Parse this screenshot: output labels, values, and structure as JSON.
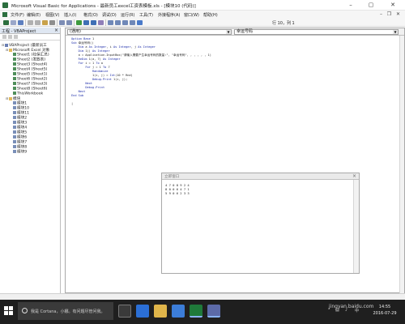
{
  "window": {
    "title": "Microsoft Visual Basic for Applications - 最新员工excel工资表模板.xls - [模块10 (代码)]"
  },
  "menu": {
    "items": [
      "文件(F)",
      "编辑(E)",
      "视图(V)",
      "插入(I)",
      "格式(O)",
      "调试(D)",
      "运行(R)",
      "工具(T)",
      "外接程序(A)",
      "窗口(W)",
      "帮助(H)"
    ]
  },
  "toolbar": {
    "position": "行 10，列 1"
  },
  "project_panel": {
    "title": "工程 - VBAProject",
    "tree": [
      {
        "text": "VBAProject (最新员工",
        "level": 0,
        "icon": "project-icon",
        "expander": "-"
      },
      {
        "text": "Microsoft Excel 对象",
        "level": 1,
        "icon": "folder-icon",
        "expander": "-"
      },
      {
        "text": "Sheet1 (社保汇总)",
        "level": 2,
        "icon": "sheet-icon",
        "expander": ""
      },
      {
        "text": "Sheet2 (发放表)",
        "level": 2,
        "icon": "sheet-icon",
        "expander": ""
      },
      {
        "text": "Sheet3 (Sheet4)",
        "level": 2,
        "icon": "sheet-icon",
        "expander": ""
      },
      {
        "text": "Sheet4 (Sheet5)",
        "level": 2,
        "icon": "sheet-icon",
        "expander": ""
      },
      {
        "text": "Sheet5 (Sheet1)",
        "level": 2,
        "icon": "sheet-icon",
        "expander": ""
      },
      {
        "text": "Sheet6 (Sheet2)",
        "level": 2,
        "icon": "sheet-icon",
        "expander": ""
      },
      {
        "text": "Sheet7 (Sheet3)",
        "level": 2,
        "icon": "sheet-icon",
        "expander": ""
      },
      {
        "text": "Sheet8 (Sheet6)",
        "level": 2,
        "icon": "sheet-icon",
        "expander": ""
      },
      {
        "text": "ThisWorkbook",
        "level": 2,
        "icon": "sheet-icon",
        "expander": ""
      },
      {
        "text": "模块",
        "level": 1,
        "icon": "folder-icon",
        "expander": "-"
      },
      {
        "text": "模块1",
        "level": 2,
        "icon": "module-icon",
        "expander": ""
      },
      {
        "text": "模块10",
        "level": 2,
        "icon": "module-icon",
        "expander": ""
      },
      {
        "text": "模块11",
        "level": 2,
        "icon": "module-icon",
        "expander": ""
      },
      {
        "text": "模块2",
        "level": 2,
        "icon": "module-icon",
        "expander": ""
      },
      {
        "text": "模块3",
        "level": 2,
        "icon": "module-icon",
        "expander": ""
      },
      {
        "text": "模块4",
        "level": 2,
        "icon": "module-icon",
        "expander": ""
      },
      {
        "text": "模块5",
        "level": 2,
        "icon": "module-icon",
        "expander": ""
      },
      {
        "text": "模块6",
        "level": 2,
        "icon": "module-icon",
        "expander": ""
      },
      {
        "text": "模块7",
        "level": 2,
        "icon": "module-icon",
        "expander": ""
      },
      {
        "text": "模块8",
        "level": 2,
        "icon": "module-icon",
        "expander": ""
      },
      {
        "text": "模块9",
        "level": 2,
        "icon": "module-icon",
        "expander": ""
      }
    ]
  },
  "code_window": {
    "object_combo": "(通用)",
    "proc_combo": "幸运号码",
    "lines": [
      "Option Base 1",
      "Sub 幸运号码()",
      "    Dim a As Integer, i As Integer, j As Integer",
      "    Dim 1() As Integer",
      "    a = Application.InputBox(\"请输入需要产生幸运号码的数量:\", \"幸运号码\", , , , , , 1)",
      "    ReDim 1(a, 7) As Integer",
      "    For i = 1 To a",
      "        For j = 1 To 7",
      "            Randomize",
      "            1(i, j) = Int(10 * Rnd)",
      "            Debug.Print 1(i, j);",
      "        Next",
      "        Debug.Print",
      "    Next",
      "End Sub",
      "",
      "|"
    ]
  },
  "immediate_window": {
    "title": "立即窗口",
    "lines": [
      "4 7 0 8 9 2 4",
      "8 0 0 6 4 7 1",
      "5 9 0 6 2 3 3"
    ]
  },
  "taskbar": {
    "search_placeholder": "我是 Cortana，小娜。有问题尽管问我。",
    "time": "14:55",
    "date": "2016-07-29"
  },
  "watermark": "jingyan.baidu.com"
}
